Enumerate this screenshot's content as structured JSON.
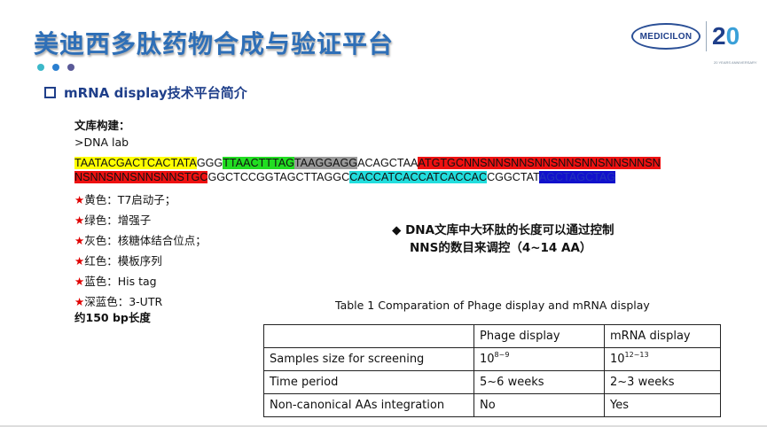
{
  "title": "美迪西多肽药物合成与验证平台",
  "dot_colors": [
    "#3cb8c9",
    "#2a7fd0",
    "#5a5a98"
  ],
  "logo": {
    "brand": "MEDICILON",
    "anniv_digit1": "2",
    "anniv_digit2": "0",
    "anniv_sub": "20 YEARS ANNIVERSARY"
  },
  "subtitle": "mRNA display技术平台简介",
  "library": {
    "heading": "文库构建：",
    "label": ">DNA lab",
    "line1": [
      {
        "text": "TAATACGACTCACTATA",
        "bg": "#ffff00",
        "fg": "#111111"
      },
      {
        "text": "GGG",
        "bg": "",
        "fg": "#111111"
      },
      {
        "text": "TTAACTTTAG",
        "bg": "#22dd22",
        "fg": "#111111"
      },
      {
        "text": "TAAGGAGG",
        "bg": "#9a9a9a",
        "fg": "#111111"
      },
      {
        "text": "ACAGCTAA",
        "bg": "",
        "fg": "#111111"
      },
      {
        "text": "ATGTGCNNSNNSNNSNNSNNSNNSNNSNNSN",
        "bg": "#ee1111",
        "fg": "#111111"
      }
    ],
    "line2": [
      {
        "text": "NSNNSNNSNNSNNSTGC",
        "bg": "#ee1111",
        "fg": "#111111"
      },
      {
        "text": "GGCTCCGGTAGCTTAGGC",
        "bg": "",
        "fg": "#111111"
      },
      {
        "text": "CACCATCACCATCACCAC",
        "bg": "#22dddd",
        "fg": "#111111"
      },
      {
        "text": "CGGCTAT",
        "bg": "",
        "fg": "#111111"
      },
      {
        "text": "AGCTAGCTAG",
        "bg": "#1111cc",
        "fg": "#2233bb"
      }
    ],
    "legend": [
      {
        "star": "★",
        "text": "黄色：T7启动子；"
      },
      {
        "star": "★",
        "text": "绿色：增强子"
      },
      {
        "star": "★",
        "text": "灰色：核糖体结合位点；"
      },
      {
        "star": "★",
        "text": "红色：模板序列"
      },
      {
        "star": "★",
        "text": "蓝色：His tag"
      },
      {
        "star": "★",
        "text": "深蓝色：3-UTR"
      }
    ],
    "length": "约150 bp长度"
  },
  "bullet": {
    "symbol": "◆",
    "line1": "DNA文库中大环肽的长度可以通过控制",
    "line2": "NNS的数目来调控（4~14 AA）"
  },
  "table": {
    "caption": "Table 1 Comparation of Phage display and mRNA display",
    "header": [
      "",
      "Phage display",
      "mRNA display"
    ],
    "rows": [
      {
        "label": "Samples size for screening",
        "phage_base": "10",
        "phage_exp": "8~9",
        "mrna_base": "10",
        "mrna_exp": "12~13"
      },
      {
        "label": "Time period",
        "phage": "5~6 weeks",
        "mrna": "2~3 weeks"
      },
      {
        "label": "Non-canonical AAs integration",
        "phage": "No",
        "mrna": "Yes"
      }
    ]
  }
}
